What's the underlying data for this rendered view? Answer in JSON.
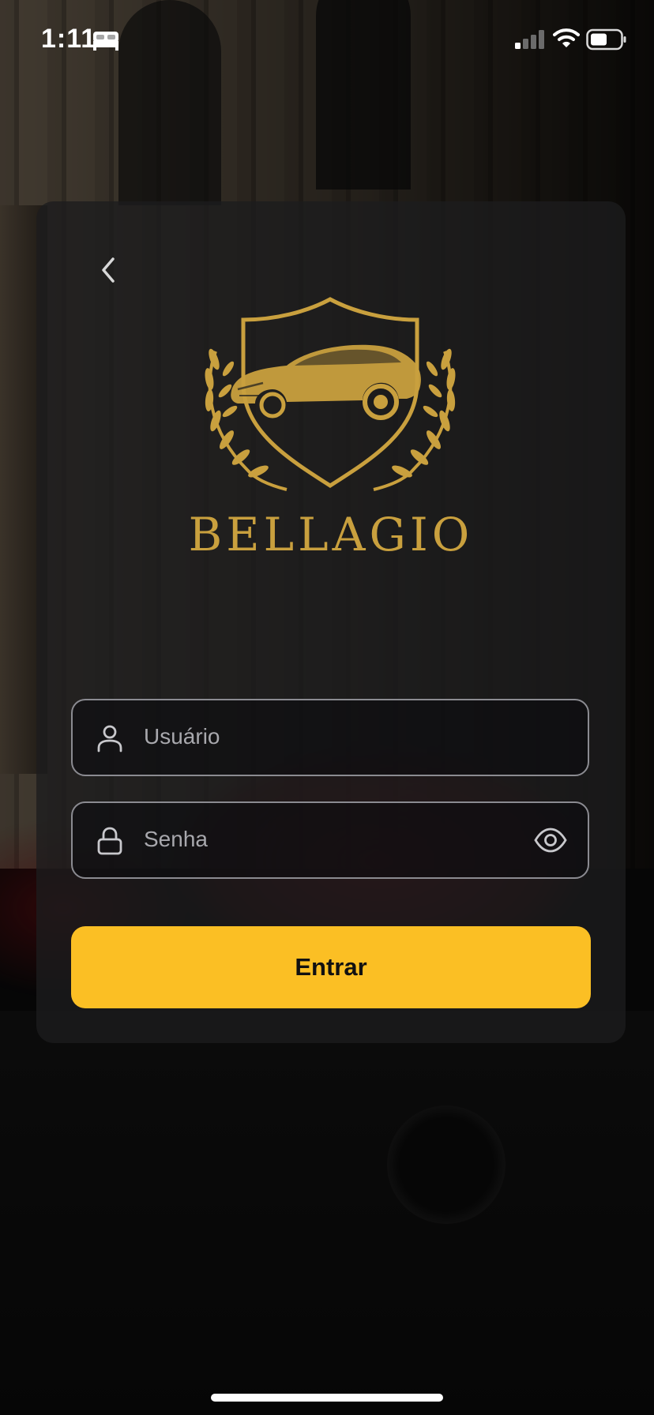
{
  "status_bar": {
    "time": "1:11"
  },
  "login": {
    "brand": "BELLAGIO",
    "username_placeholder": "Usuário",
    "password_placeholder": "Senha",
    "submit_label": "Entrar"
  },
  "colors": {
    "accent_button": "#fbbf24",
    "logo_gold": "#c9a03e",
    "card_bg": "#1c1c1e"
  },
  "icons": [
    "bed-icon",
    "signal-icon",
    "wifi-icon",
    "battery-icon",
    "back-chevron-icon",
    "bellagio-logo",
    "user-icon",
    "lock-icon",
    "eye-icon"
  ]
}
